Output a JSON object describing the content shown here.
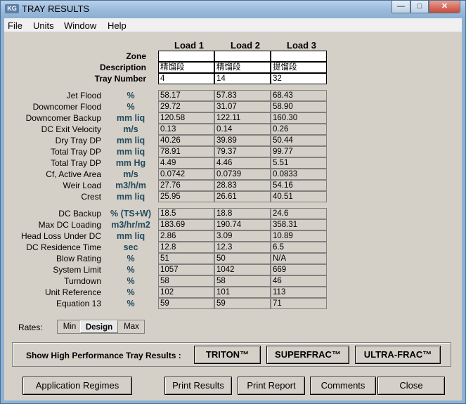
{
  "window": {
    "title": "TRAY RESULTS",
    "icon_text": "KG",
    "minimize": "—",
    "maximize": "□",
    "close": "✕"
  },
  "menu": [
    "File",
    "Units",
    "Window",
    "Help"
  ],
  "loads": [
    "Load 1",
    "Load 2",
    "Load 3"
  ],
  "header_rows": [
    {
      "label": "Zone",
      "values": [
        "",
        "",
        ""
      ]
    },
    {
      "label": "Description",
      "values": [
        "精馏段",
        "精馏段",
        "提馏段"
      ]
    },
    {
      "label": "Tray Number",
      "values": [
        "4",
        "14",
        "32"
      ]
    }
  ],
  "group1": [
    {
      "label": "Jet Flood",
      "unit": "%",
      "values": [
        "58.17",
        "57.83",
        "68.43"
      ]
    },
    {
      "label": "Downcomer Flood",
      "unit": "%",
      "values": [
        "29.72",
        "31.07",
        "58.90"
      ]
    },
    {
      "label": "Downcomer Backup",
      "unit": "mm liq",
      "values": [
        "120.58",
        "122.11",
        "160.30"
      ]
    },
    {
      "label": "DC Exit Velocity",
      "unit": "m/s",
      "values": [
        "0.13",
        "0.14",
        "0.26"
      ]
    },
    {
      "label": "Dry Tray DP",
      "unit": "mm liq",
      "values": [
        "40.26",
        "39.89",
        "50.44"
      ]
    },
    {
      "label": "Total Tray DP",
      "unit": "mm liq",
      "values": [
        "78.91",
        "79.37",
        "99.77"
      ]
    },
    {
      "label": "Total Tray DP",
      "unit": "mm Hg",
      "values": [
        "4.49",
        "4.46",
        "5.51"
      ]
    },
    {
      "label": "Cf, Active Area",
      "unit": "m/s",
      "values": [
        "0.0742",
        "0.0739",
        "0.0833"
      ]
    },
    {
      "label": "Weir Load",
      "unit": "m3/h/m",
      "values": [
        "27.76",
        "28.83",
        "54.16"
      ]
    },
    {
      "label": "Crest",
      "unit": "mm liq",
      "values": [
        "25.95",
        "26.61",
        "40.51"
      ]
    }
  ],
  "group2": [
    {
      "label": "DC Backup",
      "unit": "% (TS+W)",
      "values": [
        "18.5",
        "18.8",
        "24.6"
      ]
    },
    {
      "label": "Max DC Loading",
      "unit": "m3/hr/m2",
      "values": [
        "183.69",
        "190.74",
        "358.31"
      ]
    },
    {
      "label": "Head Loss Under DC",
      "unit": "mm liq",
      "values": [
        "2.86",
        "3.09",
        "10.89"
      ]
    },
    {
      "label": "DC Residence Time",
      "unit": "sec",
      "values": [
        "12.8",
        "12.3",
        "6.5"
      ]
    },
    {
      "label": "Blow Rating",
      "unit": "%",
      "values": [
        "51",
        "50",
        "N/A"
      ]
    },
    {
      "label": "System Limit",
      "unit": "%",
      "values": [
        "1057",
        "1042",
        "669"
      ]
    },
    {
      "label": "Turndown",
      "unit": "%",
      "values": [
        "58",
        "58",
        "46"
      ]
    },
    {
      "label": "Unit Reference",
      "unit": "%",
      "values": [
        "102",
        "101",
        "113"
      ]
    },
    {
      "label": "Equation 13",
      "unit": "%",
      "values": [
        "59",
        "59",
        "71"
      ]
    }
  ],
  "rates": {
    "label": "Rates:",
    "options": [
      "Min",
      "Design",
      "Max"
    ],
    "selected": "Design"
  },
  "high_perf": {
    "label": "Show High Performance Tray Results :",
    "buttons": [
      "TRITON™",
      "SUPERFRAC™",
      "ULTRA-FRAC™"
    ]
  },
  "bottom_buttons": {
    "application_regimes": "Application Regimes",
    "print_results": "Print Results",
    "print_report": "Print Report",
    "comments": "Comments",
    "close": "Close"
  }
}
